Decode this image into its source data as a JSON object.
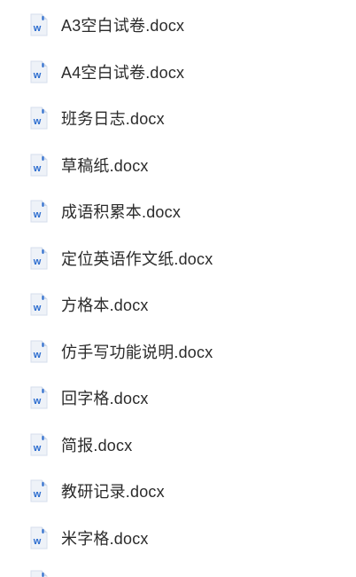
{
  "file_list": {
    "files": [
      {
        "name": "A3空白试卷.docx",
        "icon": "word-doc-icon"
      },
      {
        "name": "A4空白试卷.docx",
        "icon": "word-doc-icon"
      },
      {
        "name": "班务日志.docx",
        "icon": "word-doc-icon"
      },
      {
        "name": "草稿纸.docx",
        "icon": "word-doc-icon"
      },
      {
        "name": "成语积累本.docx",
        "icon": "word-doc-icon"
      },
      {
        "name": "定位英语作文纸.docx",
        "icon": "word-doc-icon"
      },
      {
        "name": "方格本.docx",
        "icon": "word-doc-icon"
      },
      {
        "name": "仿手写功能说明.docx",
        "icon": "word-doc-icon"
      },
      {
        "name": "回字格.docx",
        "icon": "word-doc-icon"
      },
      {
        "name": "简报.docx",
        "icon": "word-doc-icon"
      },
      {
        "name": "教研记录.docx",
        "icon": "word-doc-icon"
      },
      {
        "name": "米字格.docx",
        "icon": "word-doc-icon"
      }
    ],
    "icon_letter": "W"
  },
  "colors": {
    "icon_page": "#eef2f8",
    "icon_fold": "#c9d6ea",
    "icon_letter": "#2b6ccf",
    "text": "#2b2b2b"
  }
}
